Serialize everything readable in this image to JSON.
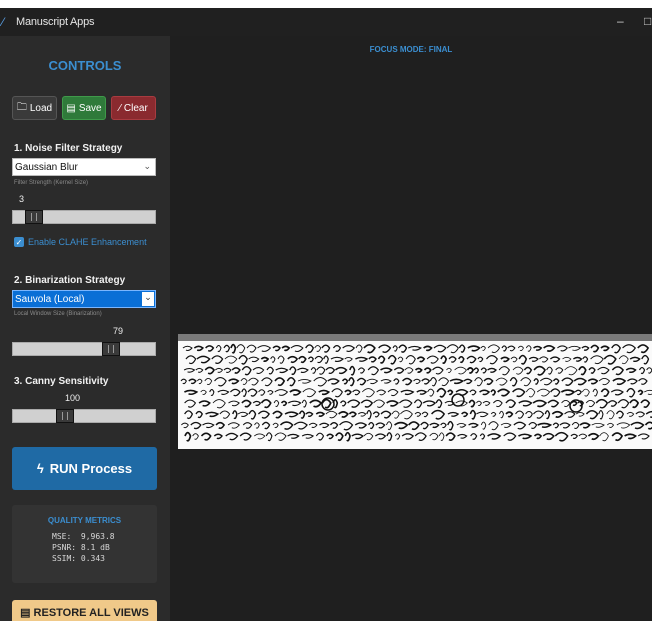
{
  "window": {
    "title": "Manuscript Apps",
    "min_glyph": "–",
    "max_glyph": "□",
    "icon": "app-icon"
  },
  "sidebar": {
    "heading": "CONTROLS",
    "buttons": {
      "load": "Load",
      "save": "Save",
      "clear": "Clear"
    },
    "noise": {
      "section_label": "1. Noise Filter Strategy",
      "selected": "Gaussian Blur",
      "sub_label": "Filter Strength (Kernel Size)",
      "value": "3",
      "level": 0.1
    },
    "clahe": {
      "label": "Enable CLAHE Enhancement",
      "checked": true
    },
    "binarization": {
      "section_label": "2. Binarization Strategy",
      "selected": "Sauvola (Local)",
      "sub_label": "Local Window Size (Binarization)",
      "value": "79",
      "level": 0.72
    },
    "canny": {
      "section_label": "3. Canny Sensitivity",
      "value": "100",
      "level": 0.35
    },
    "run_label": "RUN Process",
    "metrics": {
      "title": "QUALITY METRICS",
      "mse": "MSE:  9,963.8",
      "psnr": "PSNR: 8.1 dB",
      "ssim": "SSIM: 0.343"
    },
    "restore_label": "RESTORE ALL VIEWS"
  },
  "main": {
    "focus_mode": "FOCUS MODE: FINAL"
  },
  "colors": {
    "accent": "#3b8ed0",
    "save": "#2f7a3a",
    "clear": "#8a2a2f",
    "run": "#1f6aa5",
    "restore": "#f0c989"
  }
}
